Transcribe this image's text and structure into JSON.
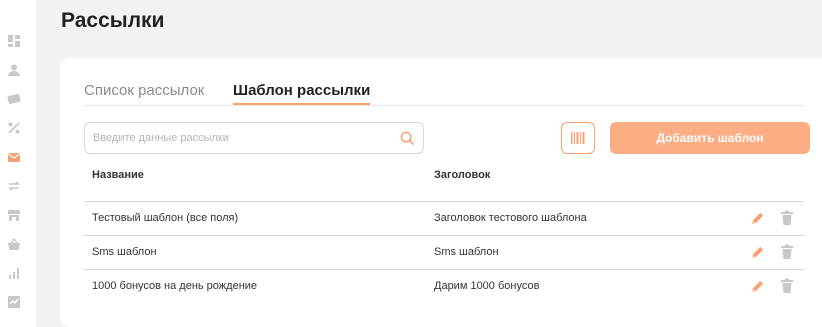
{
  "page": {
    "title": "Рассылки"
  },
  "sidebar": {
    "items": [
      {
        "icon": "dashboard-icon",
        "active": false
      },
      {
        "icon": "user-icon",
        "active": false
      },
      {
        "icon": "card-icon",
        "active": false
      },
      {
        "icon": "percent-icon",
        "active": false
      },
      {
        "icon": "mail-icon",
        "active": true
      },
      {
        "icon": "exchange-icon",
        "active": false
      },
      {
        "icon": "store-icon",
        "active": false
      },
      {
        "icon": "basket-icon",
        "active": false
      },
      {
        "icon": "stats-icon",
        "active": false
      },
      {
        "icon": "check-chart-icon",
        "active": false
      }
    ]
  },
  "tabs": [
    {
      "label": "Список рассылок",
      "active": false
    },
    {
      "label": "Шаблон рассылки",
      "active": true
    }
  ],
  "search": {
    "placeholder": "Введите данные рассылки",
    "value": ""
  },
  "toolbar": {
    "add_label": "Добавить шаблон",
    "barcode_icon": "barcode-icon"
  },
  "table": {
    "headers": {
      "name": "Название",
      "subject": "Заголовок"
    },
    "rows": [
      {
        "name": "Тестовый шаблон (все поля)",
        "subject": "Заголовок тестового шаблона"
      },
      {
        "name": "Sms шаблон",
        "subject": "Sms шаблон"
      },
      {
        "name": "1000 бонусов на день рождение",
        "subject": "Дарим 1000 бонусов"
      }
    ]
  },
  "colors": {
    "accent": "#f5a172",
    "button": "#fcad83",
    "sidebar_icon": "#c8c8c8",
    "sidebar_active": "#f5a172",
    "delete_icon": "#c8c8c8"
  }
}
